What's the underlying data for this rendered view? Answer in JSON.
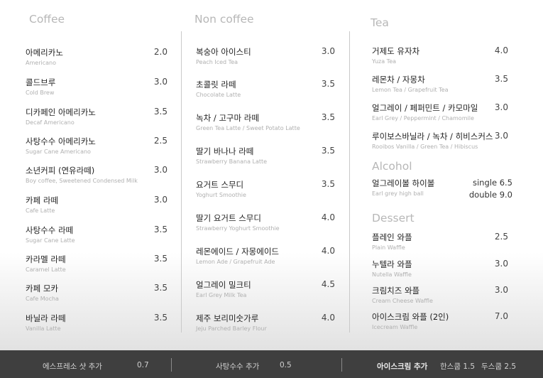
{
  "coffee": {
    "title": "Coffee",
    "items": [
      {
        "ko": "아메리카노",
        "en": "Americano",
        "price": "2.0"
      },
      {
        "ko": "콜드브루",
        "en": "Cold Brew",
        "price": "3.0"
      },
      {
        "ko": "디카페인 아메리카노",
        "en": "Decaf Americano",
        "price": "3.5"
      },
      {
        "ko": "사탕수수 아메리카노",
        "en": "Sugar Cane Americano",
        "price": "2.5"
      },
      {
        "ko": "소년커피 (연유라떼)",
        "en": "Boy coffee, Sweetened Condensed Milk",
        "price": "3.0"
      },
      {
        "ko": "카페 라떼",
        "en": "Cafe Latte",
        "price": "3.0"
      },
      {
        "ko": "사탕수수 라떼",
        "en": "Sugar Cane Latte",
        "price": "3.5"
      },
      {
        "ko": "카라멜 라떼",
        "en": "Caramel Latte",
        "price": "3.5"
      },
      {
        "ko": "카페 모카",
        "en": "Cafe Mocha",
        "price": "3.5"
      },
      {
        "ko": "바닐라 라떼",
        "en": "Vanilla Latte",
        "price": "3.5"
      }
    ]
  },
  "noncoffee": {
    "title": "Non coffee",
    "items": [
      {
        "ko": "복숭아 아이스티",
        "en": "Peach Iced Tea",
        "price": "3.0"
      },
      {
        "ko": "초콜릿 라떼",
        "en": "Chocolate Latte",
        "price": "3.5"
      },
      {
        "ko": "녹차 / 고구마 라떼",
        "en": "Green Tea Latte / Sweet Potato Latte",
        "price": "3.5"
      },
      {
        "ko": "딸기 바나나 라떼",
        "en": "Strawberry Banana Latte",
        "price": "3.5"
      },
      {
        "ko": "요거트 스무디",
        "en": "Yoghurt Smoothie",
        "price": "3.5"
      },
      {
        "ko": "딸기 요거트 스무디",
        "en": "Strawberry Yoghurt Smoothie",
        "price": "4.0"
      },
      {
        "ko": "레몬에이드 / 자몽에이드",
        "en": "Lemon Ade / Grapefruit Ade",
        "price": "4.0"
      },
      {
        "ko": "얼그레이 밀크티",
        "en": "Earl Grey Milk Tea",
        "price": "4.5"
      },
      {
        "ko": "제주 보리미숫가루",
        "en": "Jeju Parched Barley Flour",
        "price": "4.0"
      }
    ]
  },
  "tea": {
    "title": "Tea",
    "items": [
      {
        "ko": "거제도 유자차",
        "en": "Yuza Tea",
        "price": "4.0"
      },
      {
        "ko": "레몬차 / 자몽차",
        "en": "Lemon Tea / Grapefruit Tea",
        "price": "3.5"
      },
      {
        "ko": "얼그레이 / 페퍼민트 / 카모마일",
        "en": "Earl Grey / Peppermint / Chamomile",
        "price": "3.0"
      },
      {
        "ko": "루이보스바닐라 / 녹차 / 히비스커스",
        "en": "Rooibos Vanilla / Green Tea / Hibiscus",
        "price": "3.0"
      }
    ]
  },
  "alcohol": {
    "title": "Alcohol",
    "item": {
      "ko": "얼그레이볼 하이볼",
      "en": "Earl grey high ball",
      "single": "single 6.5",
      "double": "double 9.0"
    }
  },
  "dessert": {
    "title": "Dessert",
    "items": [
      {
        "ko": "플레인 와플",
        "en": "Plain Waffle",
        "price": "2.5"
      },
      {
        "ko": "누텔라 와플",
        "en": "Nutella Waffle",
        "price": "3.0"
      },
      {
        "ko": "크림치즈 와플",
        "en": "Cream Cheese Waffle",
        "price": "3.0"
      },
      {
        "ko": "아이스크림 와플 (2인)",
        "en": "Icecream Waffle",
        "price": "7.0"
      }
    ]
  },
  "footer": {
    "espresso_label": "에스프레소 샷 추가",
    "espresso_price": "0.7",
    "sugarcane_label": "사탕수수 추가",
    "sugarcane_price": "0.5",
    "icecream_label": "아이스크림 추가",
    "icecream_one": "한스쿱 1.5",
    "icecream_two": "두스쿱 2.5"
  }
}
